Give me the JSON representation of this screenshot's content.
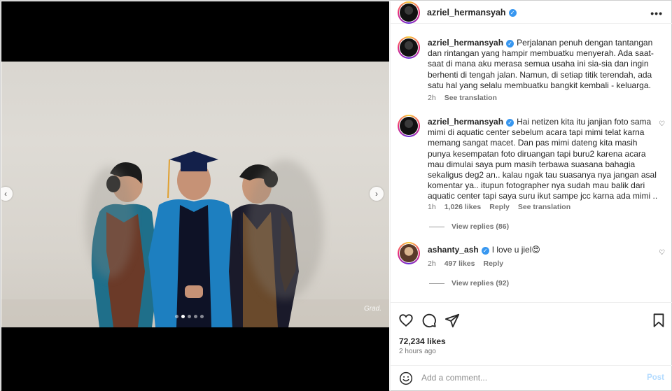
{
  "post": {
    "author": "azriel_hermansyah",
    "photo_watermark": "Grad.",
    "carousel": {
      "total": 5,
      "active_index": 1
    }
  },
  "caption": {
    "username": "azriel_hermansyah",
    "text": "Perjalanan penuh dengan tantangan dan rintangan yang hampir membuatku menyerah. Ada saat-saat di mana aku merasa semua usaha ini sia-sia dan ingin berhenti di tengah jalan. Namun, di setiap titik terendah, ada satu hal yang selalu membuatku bangkit kembali - keluarga.",
    "time": "2h",
    "see_translation": "See translation"
  },
  "comments": [
    {
      "username": "azriel_hermansyah",
      "text": "Hai netizen kita itu janjian foto sama mimi di aquatic center sebelum acara tapi mimi telat karna memang sangat macet. Dan pas mimi dateng kita masih punya kesempatan foto diruangan tapi buru2 karena acara mau dimulai saya pum masih terbawa suasana bahagia sekaligus deg2 an.. kalau ngak tau suasanya nya jangan asal komentar ya.. itupun fotographer nya sudah mau balik dari aquatic center tapi saya suru ikut sampe jcc karna ada mimi ..",
      "time": "1h",
      "likes": "1,026 likes",
      "reply": "Reply",
      "see_translation": "See translation",
      "view_replies": "View replies (86)"
    },
    {
      "username": "ashanty_ash",
      "text": "I love u jiel😍",
      "time": "2h",
      "likes": "497 likes",
      "reply": "Reply",
      "view_replies": "View replies (92)"
    }
  ],
  "actions": {
    "likes_count": "72,234 likes",
    "posted_ago": "2 hours ago"
  },
  "add_comment": {
    "placeholder": "Add a comment...",
    "post_label": "Post"
  },
  "colors": {
    "accent_blue": "#3897f0",
    "post_disabled": "#b3dbff",
    "muted_text": "#737373"
  }
}
